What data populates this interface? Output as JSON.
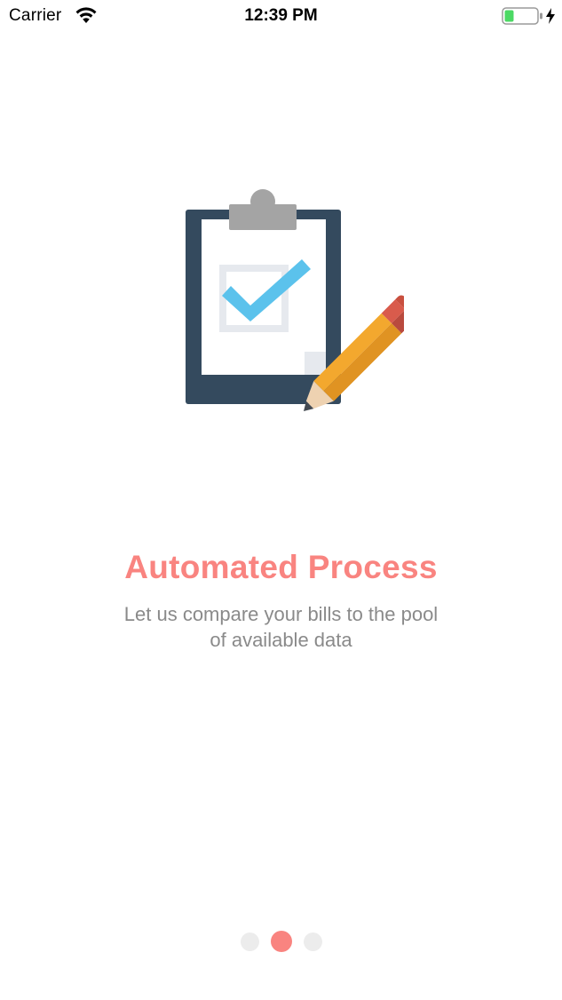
{
  "status_bar": {
    "carrier": "Carrier",
    "time": "12:39 PM",
    "wifi_icon": "wifi-icon",
    "battery_icon": "battery-icon",
    "battery_level": 0.25,
    "charging_icon": "charging-bolt-icon"
  },
  "onboarding": {
    "illustration_icon": "clipboard-checklist-pencil-icon",
    "title": "Automated Process",
    "description_line1": "Let us compare your bills to the pool",
    "description_line2": "of available data"
  },
  "pager": {
    "page_count": 3,
    "current_page": 2
  },
  "colors": {
    "accent": "#f98480",
    "text_secondary": "#8a8a8a",
    "dot_inactive": "#ececec",
    "clipboard": "#344a5e",
    "checkmark": "#5bc2ec",
    "pencil": "#f0a02a",
    "eraser": "#d95b4c"
  }
}
